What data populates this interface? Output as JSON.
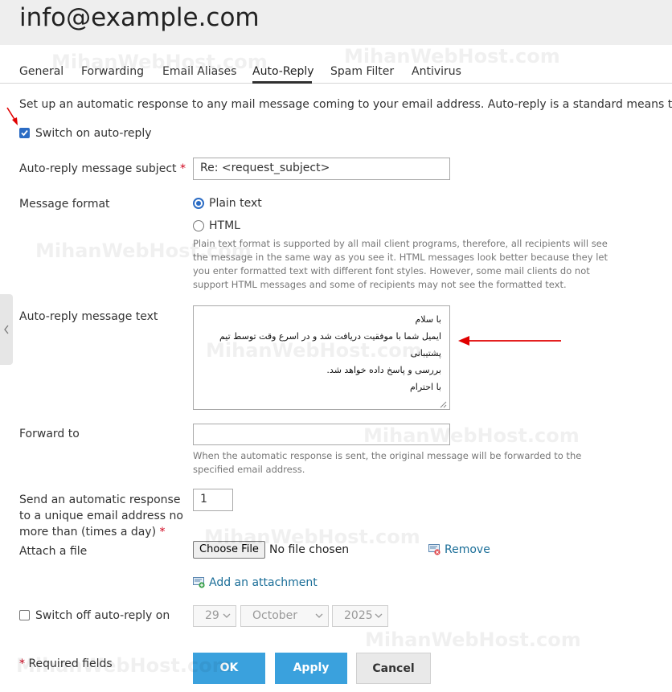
{
  "header": {
    "title": "info@example.com"
  },
  "tabs": [
    {
      "label": "General"
    },
    {
      "label": "Forwarding"
    },
    {
      "label": "Email Aliases"
    },
    {
      "label": "Auto-Reply",
      "active": true
    },
    {
      "label": "Spam Filter"
    },
    {
      "label": "Antivirus"
    }
  ],
  "description": "Set up an automatic response to any mail message coming to your email address. Auto-reply is a standard means to notify you",
  "switch_on": {
    "label": "Switch on auto-reply",
    "checked": true
  },
  "subject": {
    "label": "Auto-reply message subject",
    "required_mark": "*",
    "value": "Re: <request_subject>"
  },
  "format": {
    "label": "Message format",
    "options": [
      {
        "label": "Plain text",
        "selected": true
      },
      {
        "label": "HTML",
        "selected": false
      }
    ],
    "hint": [
      "Plain text format is supported by all mail client programs, therefore, all recipients will see",
      "the message in the same way as you see it. HTML messages look better because they let",
      "you enter formatted text with different font styles. However, some mail clients do not",
      "support HTML messages and some of recipients may not see the formatted text."
    ]
  },
  "message_text": {
    "label": "Auto-reply message text",
    "lines": [
      "با سلام",
      "ایمیل شما با موفقیت دریافت شد و در اسرع وقت توسط تیم پشتیبانی",
      "بررسی و پاسخ داده خواهد شد.",
      "با احترام"
    ]
  },
  "forward_to": {
    "label": "Forward to",
    "value": "",
    "hint": [
      "When the automatic response is sent, the original message will be forwarded to the",
      "specified email address."
    ]
  },
  "frequency": {
    "label_lines": [
      "Send an automatic response",
      "to a unique email address no",
      "more than (times a day)"
    ],
    "required_mark": "*",
    "value": "1"
  },
  "attach": {
    "label": "Attach a file",
    "choose_label": "Choose File",
    "no_file": "No file chosen",
    "remove_label": "Remove",
    "add_label": "Add an attachment"
  },
  "switch_off": {
    "label": "Switch off auto-reply on",
    "checked": false,
    "day": "29",
    "month": "October",
    "year": "2025"
  },
  "footer": {
    "required_mark": "*",
    "required_text": "Required fields",
    "ok_label": "OK",
    "apply_label": "Apply",
    "cancel_label": "Cancel"
  },
  "watermark": "MihanWebHost.com",
  "colors": {
    "accent": "#2b6cc4",
    "primary_button": "#3aa1dd",
    "link": "#1b6e98",
    "required": "#d0021b",
    "annotation_arrow": "#e00000"
  }
}
